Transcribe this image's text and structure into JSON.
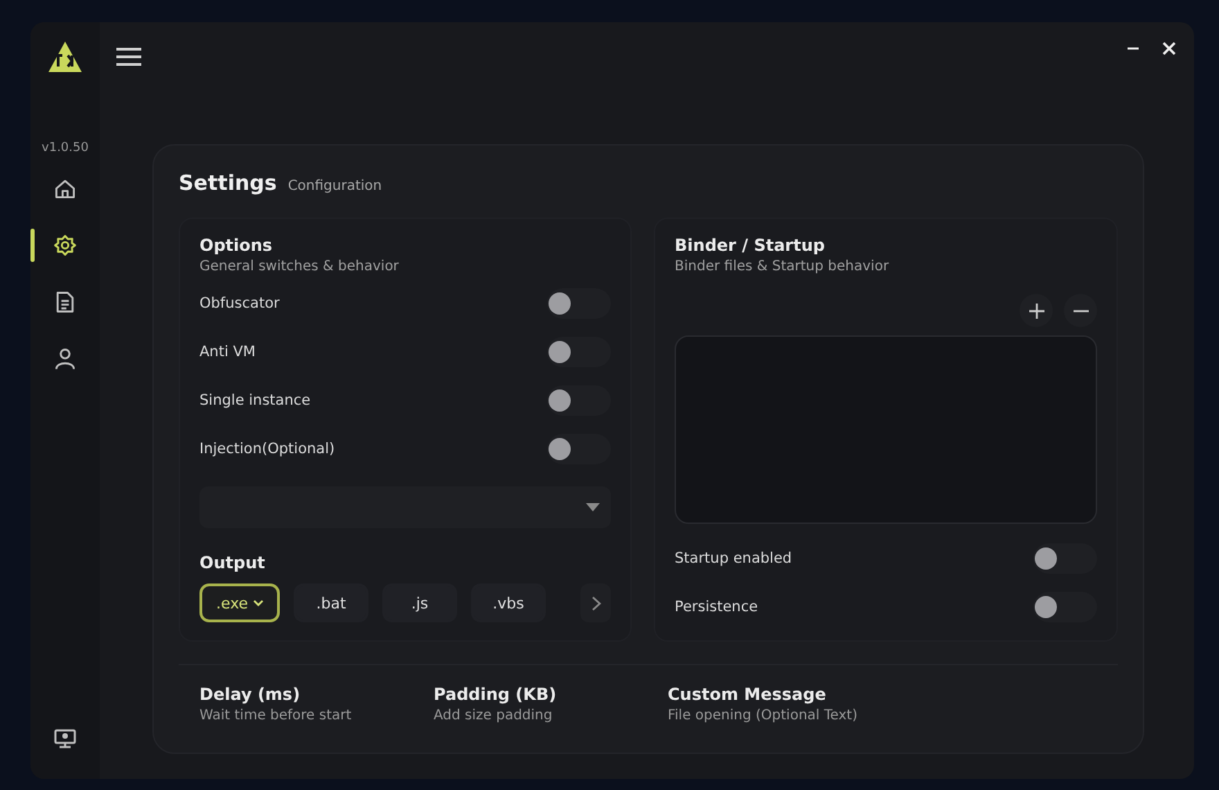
{
  "sidebar": {
    "version": "v1.0.50",
    "nav": [
      {
        "kind": "home",
        "selected": false
      },
      {
        "kind": "settings",
        "selected": true
      },
      {
        "kind": "document",
        "selected": false
      },
      {
        "kind": "user",
        "selected": false
      }
    ]
  },
  "page": {
    "title": "Settings",
    "subtitle": "Configuration"
  },
  "options": {
    "title": "Options",
    "subtitle": "General switches & behavior",
    "switches": [
      {
        "label": "Obfuscator",
        "on": false
      },
      {
        "label": "Anti VM",
        "on": false
      },
      {
        "label": "Single instance",
        "on": false
      },
      {
        "label": "Injection(Optional)",
        "on": false
      }
    ]
  },
  "output": {
    "title": "Output",
    "formats": [
      {
        "label": ".exe",
        "selected": true
      },
      {
        "label": ".bat",
        "selected": false
      },
      {
        "label": ".js",
        "selected": false
      },
      {
        "label": ".vbs",
        "selected": false
      }
    ]
  },
  "binder": {
    "title": "Binder / Startup",
    "subtitle": "Binder files & Startup behavior",
    "switches": [
      {
        "label": "Startup enabled",
        "on": false
      },
      {
        "label": "Persistence",
        "on": false
      }
    ]
  },
  "fields": [
    {
      "title": "Delay (ms)",
      "subtitle": "Wait time before start"
    },
    {
      "title": "Padding (KB)",
      "subtitle": "Add size padding"
    },
    {
      "title": "Custom Message",
      "subtitle": "File opening (Optional Text)"
    }
  ]
}
